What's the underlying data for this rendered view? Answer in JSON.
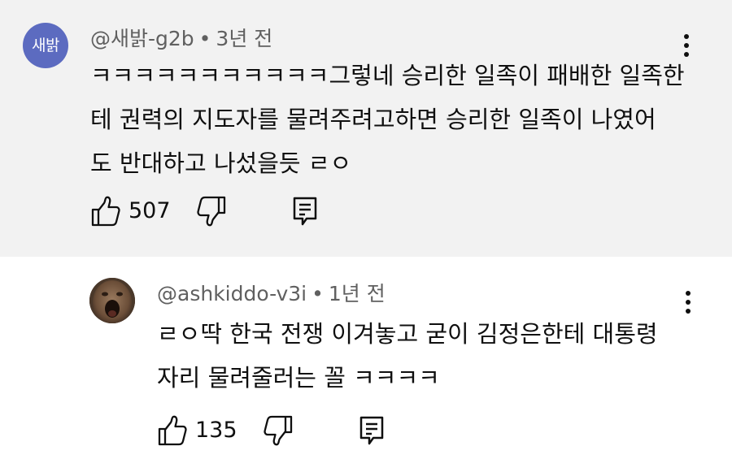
{
  "comments": [
    {
      "avatar_text": "새밝",
      "author": "@새밝-g2b",
      "separator": "•",
      "time": "3년 전",
      "lines": [
        "ㅋㅋㅋㅋㅋㅋㅋㅋㅋㅋㅋ그렇네 승리한 일족이 패배한 일족한",
        "테 권력의 지도자를 물려주려고하면 승리한 일족이 나였어",
        "도 반대하고 나섰을듯 ㄹㅇ"
      ],
      "likes": "507",
      "icons": {
        "like": "thumbs-up-icon",
        "dislike": "thumbs-down-icon",
        "reply": "reply-icon",
        "more": "more-vertical-icon"
      }
    },
    {
      "author": "@ashkiddo-v3i",
      "separator": "•",
      "time": "1년 전",
      "lines": [
        "ㄹㅇ딱 한국 전쟁 이겨놓고 굳이 김정은한테 대통령",
        "자리 물려줄러는 꼴 ㅋㅋㅋㅋ"
      ],
      "likes": "135",
      "icons": {
        "like": "thumbs-up-icon",
        "dislike": "thumbs-down-icon",
        "reply": "reply-icon",
        "more": "more-vertical-icon"
      }
    }
  ],
  "colors": {
    "highlight_bg": "#f2f2f2",
    "avatar_bg": "#5c6bc0",
    "meta_text": "#606060",
    "body_text": "#0f0f0f"
  }
}
